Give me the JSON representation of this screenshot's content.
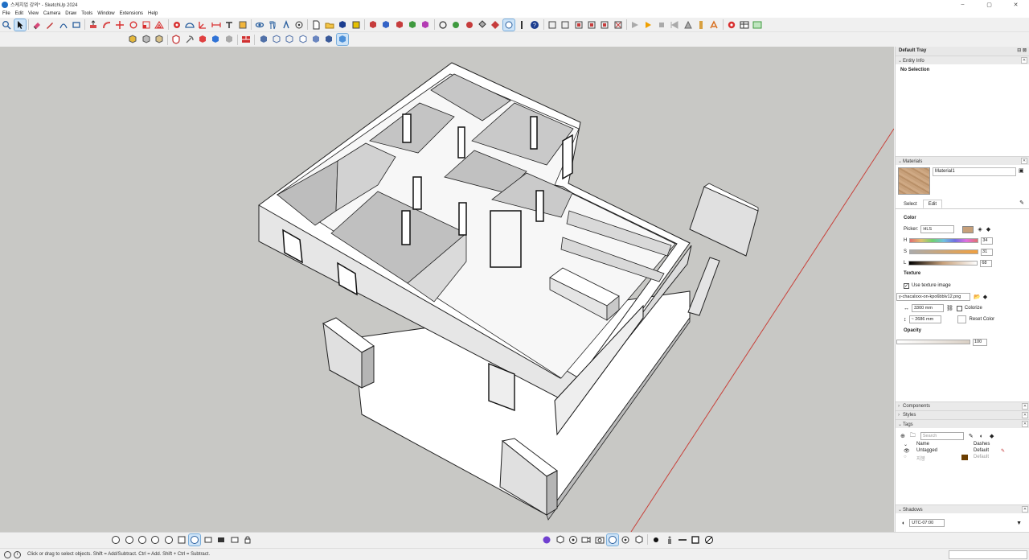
{
  "window": {
    "title": "스케치업 강의* - SketchUp 2024",
    "controls": [
      "–",
      "▢",
      "✕"
    ]
  },
  "menu": [
    "File",
    "Edit",
    "View",
    "Camera",
    "Draw",
    "Tools",
    "Window",
    "Extensions",
    "Help"
  ],
  "tray": {
    "title": "Default Tray",
    "entity_info": {
      "header": "Entity Info",
      "selection": "No Selection"
    },
    "materials": {
      "header": "Materials",
      "name": "Material1",
      "tabs": [
        "Select",
        "Edit"
      ],
      "active_tab": "Edit",
      "color_label": "Color",
      "picker_label": "Picker:",
      "picker_value": "HLS",
      "h": {
        "label": "H",
        "value": "34"
      },
      "s": {
        "label": "S",
        "value": "31"
      },
      "l": {
        "label": "L",
        "value": "68"
      },
      "texture_label": "Texture",
      "use_texture": "Use texture image",
      "texture_file": "y-chacalxxx-on-kpo6bblv12.png",
      "width": "3300 mm",
      "height": "~ 2686 mm",
      "colorize": "Colorize",
      "reset_color": "Reset Color",
      "opacity_label": "Opacity",
      "opacity_value": "100"
    },
    "components": {
      "header": "Components"
    },
    "styles": {
      "header": "Styles"
    },
    "tags": {
      "header": "Tags",
      "search_placeholder": "Search",
      "col_name": "Name",
      "col_dashes": "Dashes",
      "rows": [
        {
          "name": "Untagged",
          "dashes": "Default",
          "color": "#ffffff"
        },
        {
          "name": "지붕",
          "dashes": "Default",
          "color": "#6b3e00"
        }
      ]
    },
    "shadows": {
      "header": "Shadows",
      "timezone": "UTC-07:00"
    }
  },
  "status": {
    "hint": "Click or drag to select objects. Shift = Add/Subtract. Ctrl = Add. Shift + Ctrl = Subtract."
  },
  "colors": {
    "viewport_bg": "#c8c8c5",
    "wall_top": "#ffffff",
    "wall_side": "#e2e2e2",
    "wall_shadow": "#b7b7b7",
    "axis_red": "#c8413a"
  }
}
